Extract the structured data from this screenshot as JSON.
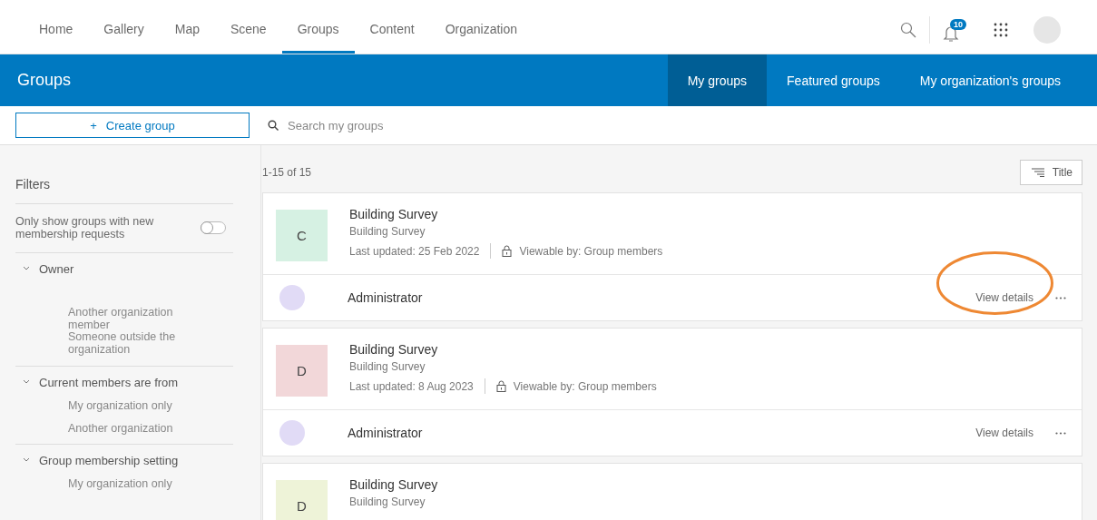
{
  "nav": {
    "items": [
      {
        "label": "Home",
        "selected": false
      },
      {
        "label": "Gallery",
        "selected": false
      },
      {
        "label": "Map",
        "selected": false
      },
      {
        "label": "Scene",
        "selected": false
      },
      {
        "label": "Groups",
        "selected": true
      },
      {
        "label": "Content",
        "selected": false
      },
      {
        "label": "Organization",
        "selected": false
      }
    ],
    "notification_count": "10"
  },
  "header": {
    "title": "Groups",
    "tabs": [
      {
        "label": "My groups",
        "selected": true
      },
      {
        "label": "Featured groups",
        "selected": false
      },
      {
        "label": "My organization's groups",
        "selected": false
      }
    ]
  },
  "toolbar": {
    "create_icon": "+",
    "create_label": "Create group",
    "search": {
      "placeholder": "Search my groups"
    }
  },
  "filters": {
    "title": "Filters",
    "toggle": {
      "label": "Only show groups with new membership requests",
      "on": false
    },
    "sections": [
      {
        "label": "Owner",
        "expanded": true,
        "options": [
          "Another organization member",
          "Someone outside the organization"
        ]
      },
      {
        "label": "Current members are from",
        "expanded": true,
        "options": [
          "My organization only",
          "Another organization"
        ]
      },
      {
        "label": "Group membership setting",
        "expanded": true,
        "options": [
          "My organization only"
        ]
      }
    ]
  },
  "results": {
    "count": "1-15 of 15",
    "sort_label": "Title",
    "groups": [
      {
        "initial": "C",
        "color": "#d6f1e3",
        "title": "Building Survey",
        "subtitle": "Building Survey",
        "updated": "Last updated: 25 Feb 2022",
        "access": "Viewable by: Group members",
        "owner": "Administrator",
        "action": "View details",
        "circled": true
      },
      {
        "initial": "D",
        "color": "#f2d7d9",
        "title": "Building Survey",
        "subtitle": "Building Survey",
        "updated": "Last updated: 8 Aug 2023",
        "access": "Viewable by: Group members",
        "owner": "Administrator",
        "action": "View details",
        "circled": false
      },
      {
        "initial": "D",
        "color": "#eef3d8",
        "title": "Building Survey",
        "subtitle": "Building Survey"
      }
    ]
  }
}
